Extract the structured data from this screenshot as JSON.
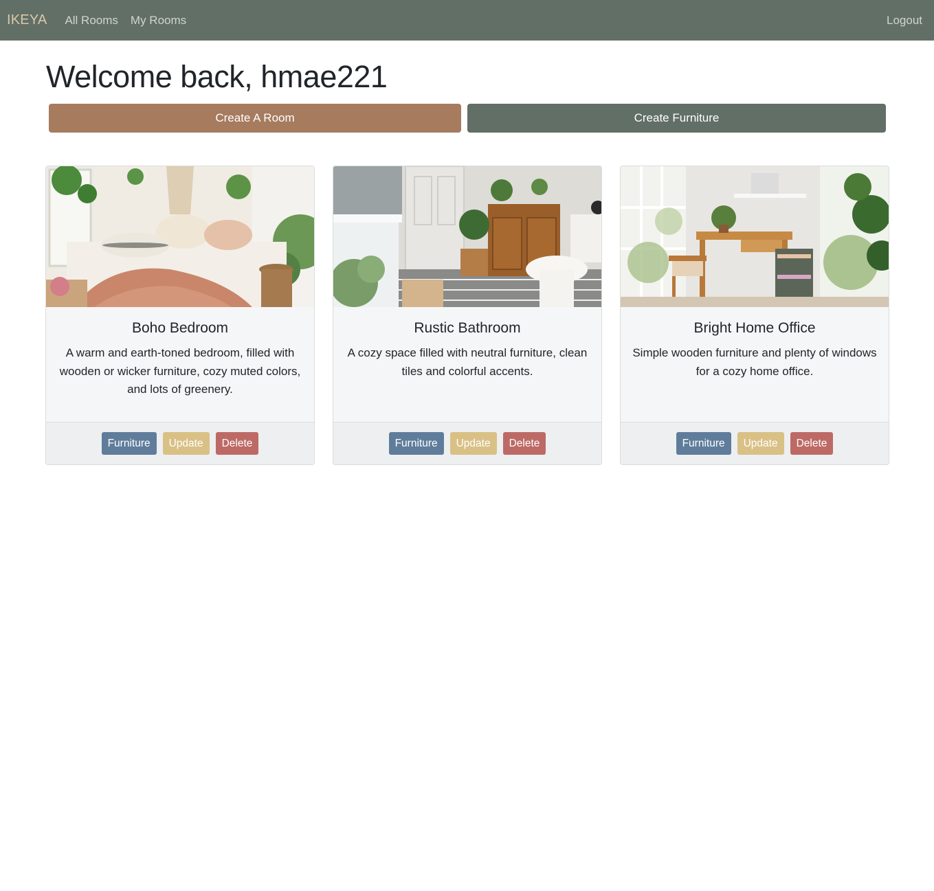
{
  "navbar": {
    "brand": "IKEYA",
    "links": [
      "All Rooms",
      "My Rooms"
    ],
    "logout": "Logout"
  },
  "welcome": "Welcome back, hmae221",
  "actions": {
    "create_room": "Create A Room",
    "create_furniture": "Create Furniture"
  },
  "rooms": [
    {
      "title": "Boho Bedroom",
      "description": "A warm and earth-toned bedroom, filled with wooden or wicker furniture, cozy muted colors, and lots of greenery.",
      "buttons": {
        "furniture": "Furniture",
        "update": "Update",
        "delete": "Delete"
      }
    },
    {
      "title": "Rustic Bathroom",
      "description": "A cozy space filled with neutral furniture, clean tiles and colorful accents.",
      "buttons": {
        "furniture": "Furniture",
        "update": "Update",
        "delete": "Delete"
      }
    },
    {
      "title": "Bright Home Office",
      "description": "Simple wooden furniture and plenty of windows for a cozy home office.",
      "buttons": {
        "furniture": "Furniture",
        "update": "Update",
        "delete": "Delete"
      }
    }
  ],
  "colors": {
    "navbar": "#626f66",
    "brand": "#d9c9a8",
    "create_room": "#a67b5e",
    "create_furniture": "#626f66",
    "furniture_button": "#5f7d9b",
    "update_button": "#d9c185",
    "delete_button": "#bd6a66"
  }
}
